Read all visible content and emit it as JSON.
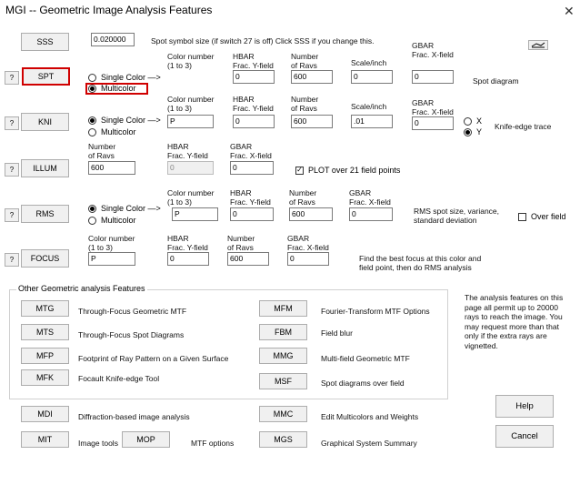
{
  "window": {
    "title": "MGI -- Geometric Image Analysis Features",
    "close": "✕"
  },
  "sss": {
    "button": "SSS",
    "value": "0.020000",
    "desc": "Spot symbol size (if switch 27 is off) Click SSS if you change this.",
    "gbar_label": "GBAR\nFrac. X-field"
  },
  "spt": {
    "help": "?",
    "button": "SPT",
    "single": "Single Color —>",
    "multi": "Multicolor",
    "color_label": "Color number\n(1 to 3)",
    "hbar_label": "HBAR\nFrac. Y-field",
    "hbar": "0",
    "rays_label": "Number\nof Ravs",
    "rays": "600",
    "scale_label": "Scale/inch",
    "scale": "0",
    "gbar": "0",
    "desc": "Spot diagram"
  },
  "kni": {
    "help": "?",
    "button": "KNI",
    "single": "Single Color —>",
    "multi": "Multicolor",
    "color_label": "Color number\n(1 to 3)",
    "color": "P",
    "hbar_label": "HBAR\nFrac. Y-field",
    "hbar": "0",
    "rays_label": "Number\nof Ravs",
    "rays": "600",
    "scale_label": "Scale/inch",
    "scale": ".01",
    "gbar_label": "GBAR\nFrac. X-field",
    "gbar": "0",
    "x": "X",
    "y": "Y",
    "desc": "Knife-edge trace"
  },
  "illum": {
    "help": "?",
    "button": "ILLUM",
    "rays_label": "Number\nof Ravs",
    "rays": "600",
    "hbar_label": "HBAR\nFrac. Y-field",
    "hbar": "0",
    "gbar_label": "GBAR\nFrac. X-field",
    "gbar": "0",
    "plot": "PLOT over 21 field points",
    "plot_checked": true
  },
  "rms": {
    "help": "?",
    "button": "RMS",
    "single": "Single Color —>",
    "multi": "Multicolor",
    "color_label": "Color number\n(1 to 3)",
    "color": "P",
    "hbar_label": "HBAR\nFrac. Y-field",
    "hbar": "0",
    "rays_label": "Number\nof Ravs",
    "rays": "600",
    "gbar_label": "GBAR\nFrac. X-field",
    "gbar": "0",
    "desc": "RMS spot size, variance,\nstandard deviation",
    "overfield": "Over field"
  },
  "focus": {
    "help": "?",
    "button": "FOCUS",
    "color_label": "Color number\n(1 to 3)",
    "color": "P",
    "hbar_label": "HBAR\nFrac. Y-field",
    "hbar": "0",
    "rays_label": "Number\nof Ravs",
    "rays": "600",
    "gbar_label": "GBAR\nFrac. X-field",
    "gbar": "0",
    "desc": "Find the best focus at this color and\nfield point, then do RMS analysis"
  },
  "other": {
    "group_label": "Other Geometric analysis Features",
    "mtg": {
      "button": "MTG",
      "desc": "Through-Focus Geometric MTF"
    },
    "mts": {
      "button": "MTS",
      "desc": "Through-Focus Spot Diagrams"
    },
    "mfp": {
      "button": "MFP",
      "desc": "Footprint of Ray Pattern on a Given Surface"
    },
    "mfk": {
      "button": "MFK",
      "desc": "Focault Knife-edge Tool"
    },
    "mfm": {
      "button": "MFM",
      "desc": "Fourier-Transform MTF Options"
    },
    "fbm": {
      "button": "FBM",
      "desc": "Field blur"
    },
    "mmg": {
      "button": "MMG",
      "desc": "Multi-field Geometric MTF"
    },
    "msf": {
      "button": "MSF",
      "desc": "Spot diagrams over field"
    },
    "mdi": {
      "button": "MDI",
      "desc": "Diffraction-based image analysis"
    },
    "mit": {
      "button": "MIT",
      "desc": "Image tools"
    },
    "mop": {
      "button": "MOP",
      "desc": "MTF options"
    },
    "mmc": {
      "button": "MMC",
      "desc": "Edit Multicolors and Weights"
    },
    "mgs": {
      "button": "MGS",
      "desc": "Graphical System Summary"
    }
  },
  "note": "The analysis features on this\npage all permit up to 20000\nrays to reach the image. You\nmay request more than that\nonly if the extra rays are\nvignetted.",
  "help_button": "Help",
  "cancel_button": "Cancel"
}
